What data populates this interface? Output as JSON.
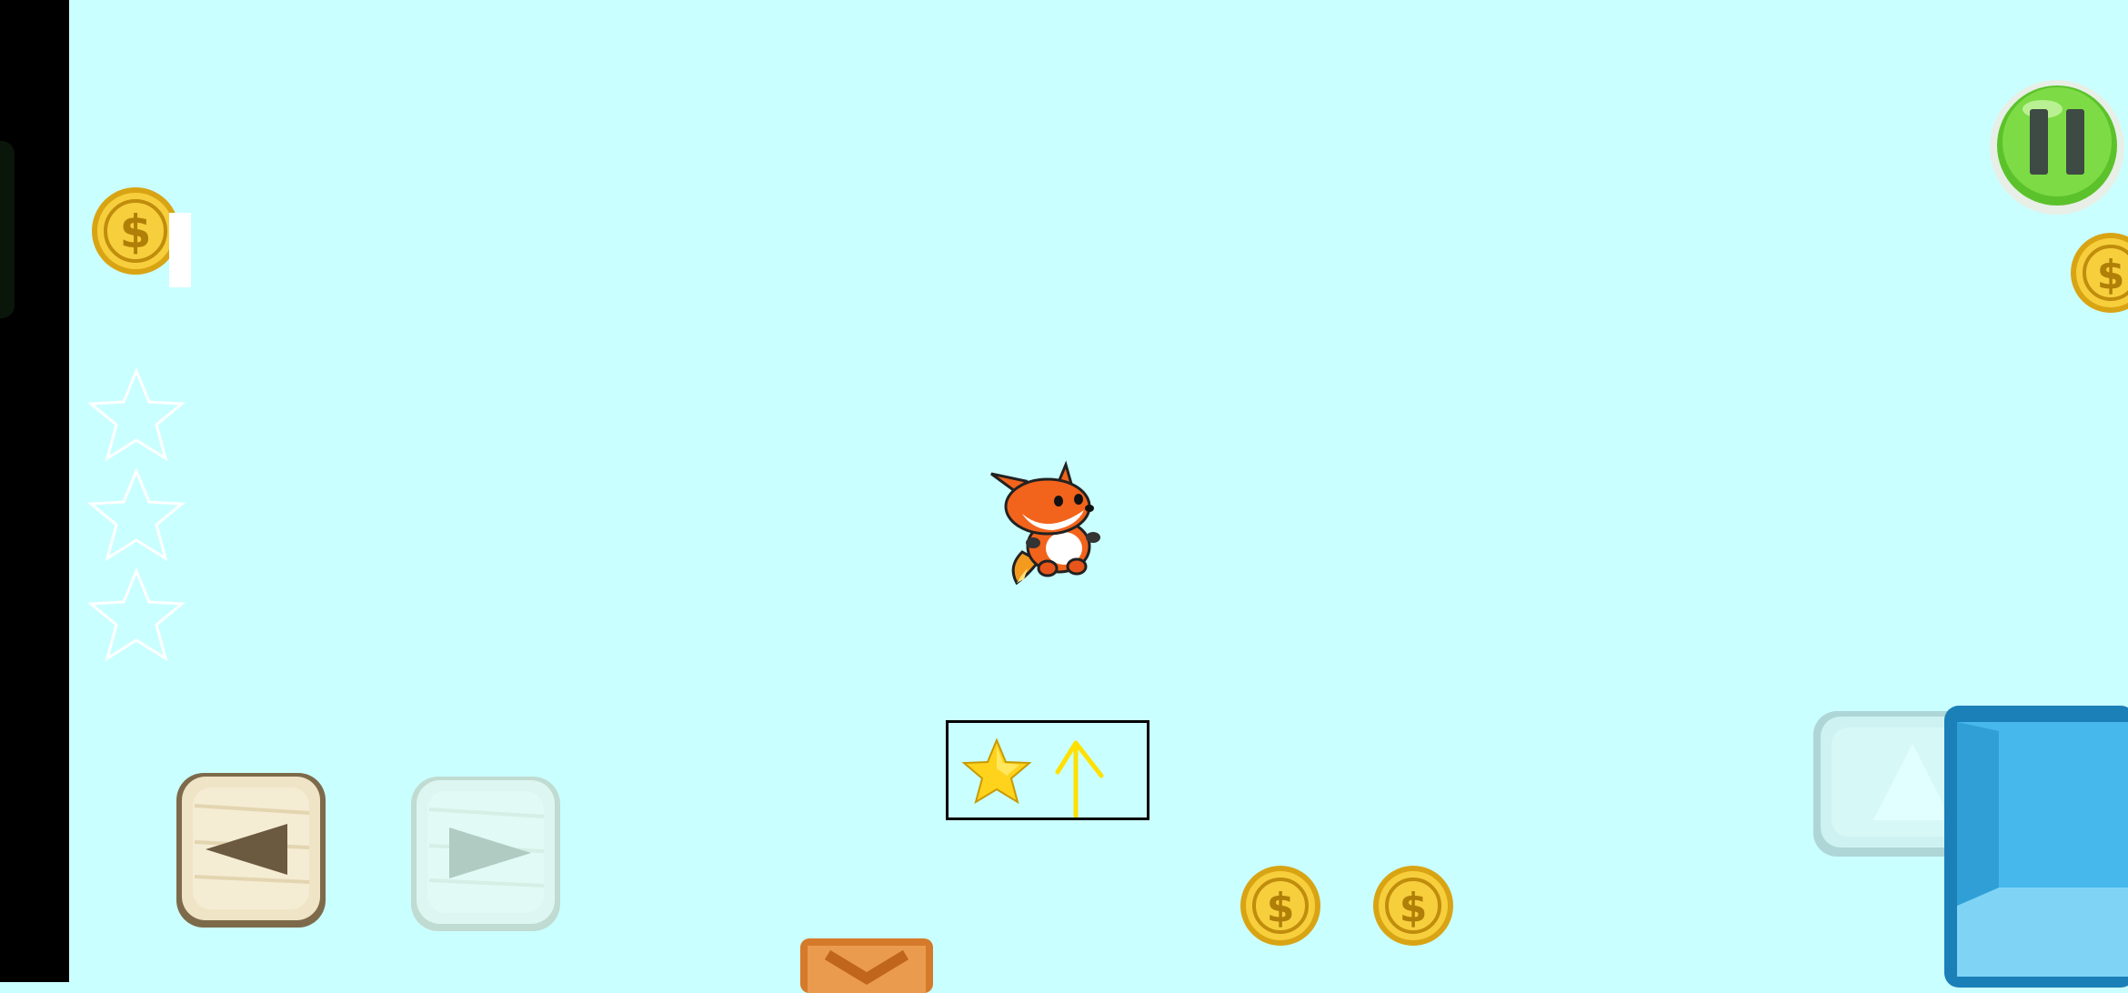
{
  "game": {
    "coin_count": "",
    "stars_total": 3,
    "stars_collected": 0
  },
  "controls": {
    "left": "left-arrow-icon",
    "right": "right-arrow-icon",
    "jump": "up-arrow-icon",
    "pause": "pause-icon"
  },
  "hint": {
    "star_icon": "star-icon",
    "arrow_icon": "up-arrow-icon"
  },
  "colors": {
    "sky": "#caffff",
    "coin_gold": "#f2c430",
    "pause_green": "#6fd63a",
    "block_blue": "#3fb6ec",
    "block_orange": "#e58f3e",
    "hint_yellow": "#ffe000"
  }
}
